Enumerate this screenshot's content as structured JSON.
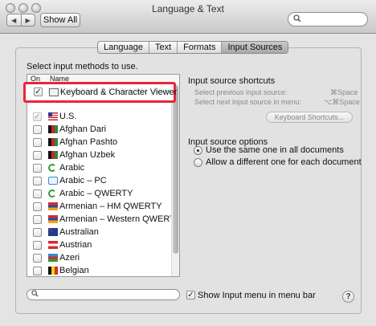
{
  "window": {
    "title": "Language & Text"
  },
  "toolbar": {
    "back_icon": "◀",
    "forward_icon": "▶",
    "show_all": "Show All",
    "search_placeholder": ""
  },
  "tabs": [
    {
      "label": "Language",
      "active": false
    },
    {
      "label": "Text",
      "active": false
    },
    {
      "label": "Formats",
      "active": false
    },
    {
      "label": "Input Sources",
      "active": true
    }
  ],
  "main": {
    "prompt": "Select input methods to use.",
    "list_header": {
      "on": "On",
      "name": "Name"
    },
    "items": [
      {
        "label": "Keyboard & Character Viewer",
        "checked": true,
        "icon": "keyboard-viewer-icon"
      },
      {
        "label": "U.S.",
        "checked": true,
        "icon": "flag-us-icon"
      },
      {
        "label": "Afghan Dari",
        "checked": false,
        "icon": "flag-afghanistan-icon"
      },
      {
        "label": "Afghan Pashto",
        "checked": false,
        "icon": "flag-afghanistan-icon"
      },
      {
        "label": "Afghan Uzbek",
        "checked": false,
        "icon": "flag-afghanistan-icon"
      },
      {
        "label": "Arabic",
        "checked": false,
        "icon": "crescent-icon"
      },
      {
        "label": "Arabic – PC",
        "checked": false,
        "icon": "arabic-letter-icon"
      },
      {
        "label": "Arabic – QWERTY",
        "checked": false,
        "icon": "crescent-icon"
      },
      {
        "label": "Armenian – HM QWERTY",
        "checked": false,
        "icon": "flag-armenia-icon"
      },
      {
        "label": "Armenian – Western QWERTY",
        "checked": false,
        "icon": "flag-armenia-icon"
      },
      {
        "label": "Australian",
        "checked": false,
        "icon": "flag-australia-icon"
      },
      {
        "label": "Austrian",
        "checked": false,
        "icon": "flag-austria-icon"
      },
      {
        "label": "Azeri",
        "checked": false,
        "icon": "flag-azerbaijan-icon"
      },
      {
        "label": "Belgian",
        "checked": false,
        "icon": "flag-belgium-icon"
      }
    ],
    "shortcuts": {
      "title": "Input source shortcuts",
      "previous_label": "Select previous input source:",
      "previous_key": "⌘Space",
      "next_label": "Select next input source in menu:",
      "next_key": "⌥⌘Space",
      "button": "Keyboard Shortcuts..."
    },
    "options": {
      "title": "Input source options",
      "same_label": "Use the same one in all documents",
      "different_label": "Allow a different one for each document",
      "selected": "same"
    },
    "show_menu_label": "Show Input menu in menu bar",
    "show_menu_checked": true,
    "help_label": "?"
  },
  "colors": {
    "highlight": "#e8263a"
  }
}
